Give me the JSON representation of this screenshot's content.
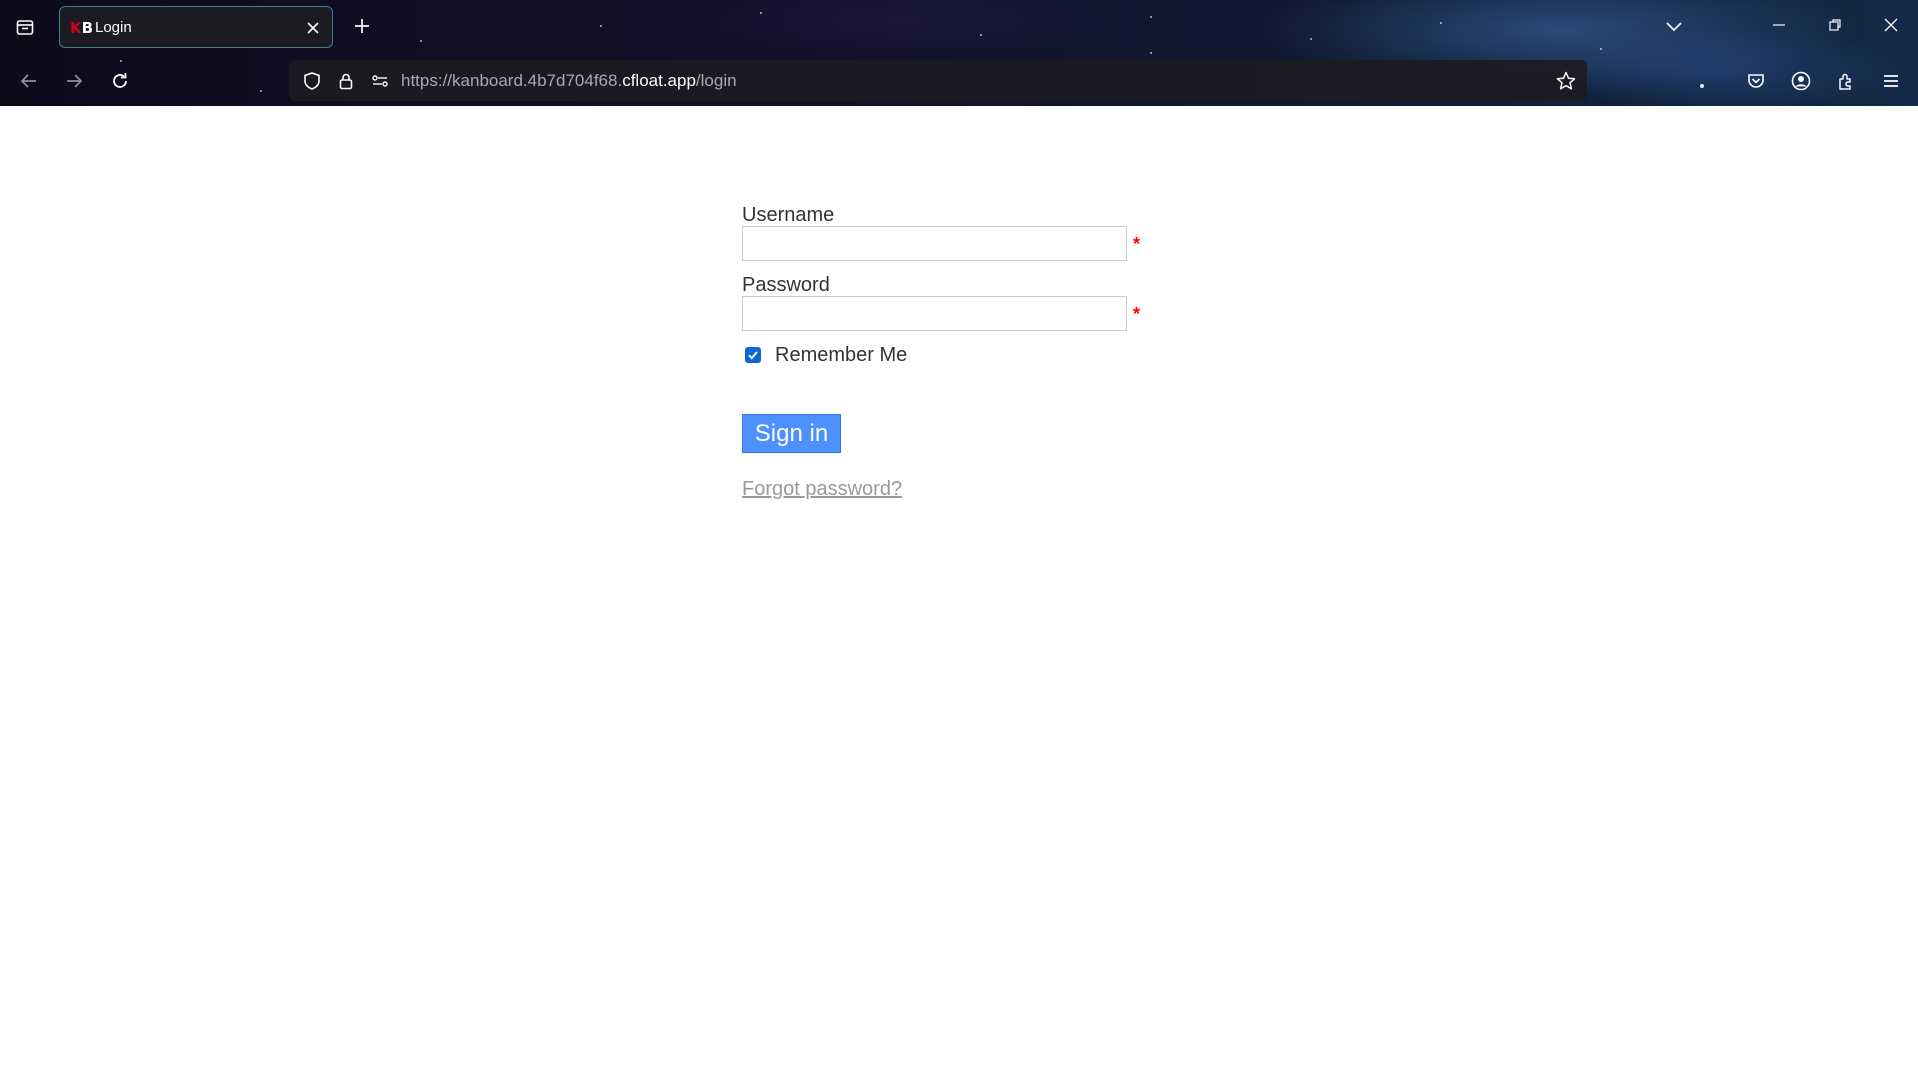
{
  "browser": {
    "tab": {
      "title": "Login",
      "favicon_k": "K",
      "favicon_b": "B"
    },
    "url": {
      "scheme": "https://",
      "subdomain": "kanboard.4b7d704f68.",
      "domain": "cfloat.app",
      "path": "/login"
    },
    "icons": [
      "tab-list-icon",
      "close-icon",
      "plus-icon",
      "chevron-down-icon",
      "minimize-icon",
      "restore-icon",
      "close-window-icon",
      "back-arrow-icon",
      "forward-arrow-icon",
      "reload-icon",
      "shield-icon",
      "lock-icon",
      "permissions-icon",
      "star-icon",
      "pocket-icon",
      "account-icon",
      "extensions-icon",
      "hamburger-menu-icon"
    ],
    "colors": {
      "tab_border": "#3e7f8e",
      "url_bg": "#1c1b22"
    }
  },
  "login": {
    "username_label": "Username",
    "username_value": "",
    "password_label": "Password",
    "password_value": "",
    "required_mark": "*",
    "remember_me_label": "Remember Me",
    "remember_me_checked": true,
    "sign_in_label": "Sign in",
    "forgot_password_label": "Forgot password?",
    "colors": {
      "button": "#4d90fe",
      "required": "#ff0000",
      "checkbox": "#0b66d8",
      "link": "#999999"
    }
  }
}
